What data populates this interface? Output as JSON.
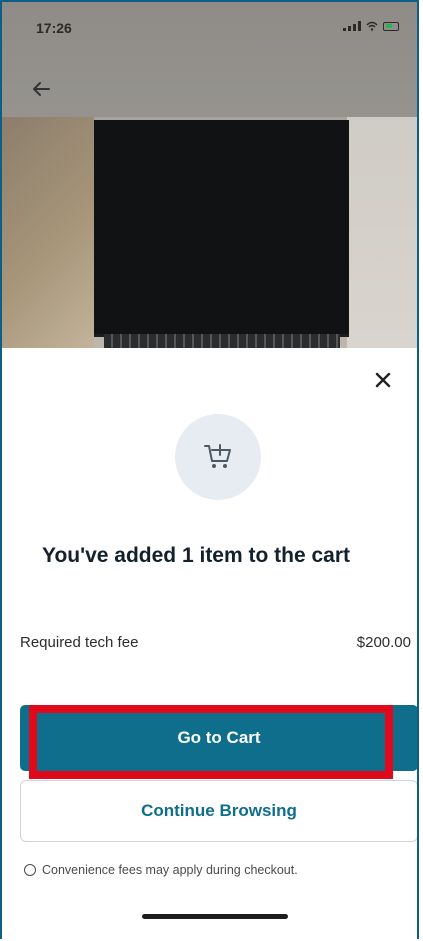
{
  "status_bar": {
    "time": "17:26"
  },
  "sheet": {
    "icons": {
      "back": "back-arrow-icon",
      "close": "close-icon",
      "cart": "cart-add-icon",
      "info": "info-icon"
    },
    "heading": "You've added 1 item to the cart",
    "fee_label": "Required tech fee",
    "fee_value": "$200.00",
    "primary_button_label": "Go to Cart",
    "secondary_button_label": "Continue Browsing",
    "footnote": "Convenience fees may apply during checkout."
  },
  "colors": {
    "primary": "#0e6e8c",
    "highlight": "#e0081b",
    "heading_text": "#14202b",
    "cart_circle": "#e6ecf1"
  }
}
